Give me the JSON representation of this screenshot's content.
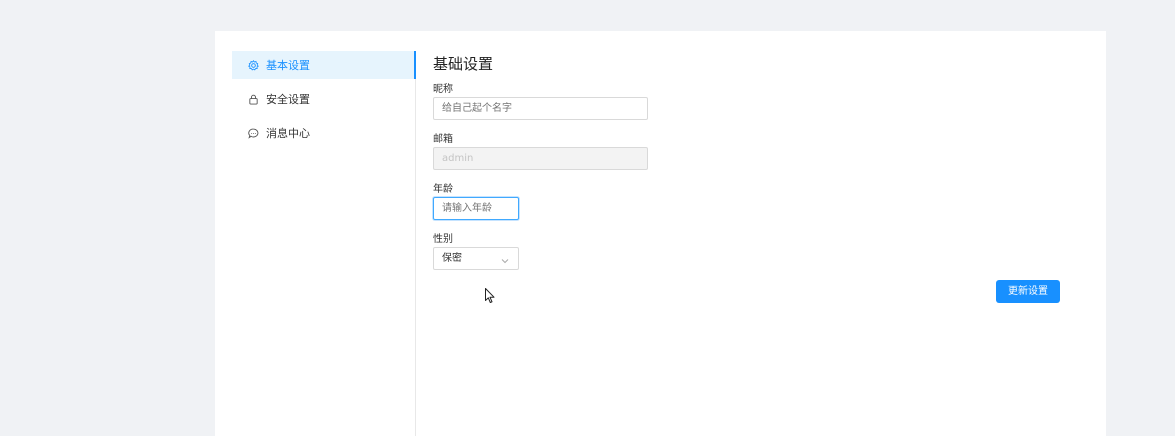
{
  "sidebar": {
    "items": [
      {
        "label": "基本设置",
        "icon": "gear-icon",
        "active": true
      },
      {
        "label": "安全设置",
        "icon": "lock-icon",
        "active": false
      },
      {
        "label": "消息中心",
        "icon": "message-icon",
        "active": false
      }
    ]
  },
  "form": {
    "title": "基础设置",
    "nickname": {
      "label": "昵称",
      "placeholder": "给自己起个名字"
    },
    "email": {
      "label": "邮箱",
      "value": "admin"
    },
    "age": {
      "label": "年龄",
      "placeholder": "请输入年龄"
    },
    "gender": {
      "label": "性别",
      "value": "保密"
    },
    "submit_label": "更新设置"
  },
  "colors": {
    "accent": "#1890ff",
    "active_bg": "#e6f4fd",
    "page_bg": "#f0f2f5"
  }
}
